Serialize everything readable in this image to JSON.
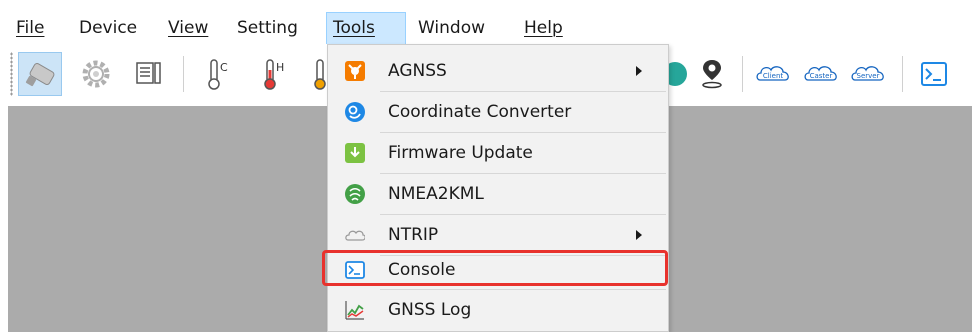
{
  "menubar": {
    "items": [
      {
        "label": "File"
      },
      {
        "label": "Device"
      },
      {
        "label": "View"
      },
      {
        "label": "Setting"
      },
      {
        "label": "Tools"
      },
      {
        "label": "Window"
      },
      {
        "label": "Help"
      }
    ],
    "open_menu": "Tools"
  },
  "toolbar": {
    "icons": [
      "connect-icon",
      "settings-gear-icon",
      "document-icon",
      "thermometer-cold-icon",
      "thermometer-hot-icon",
      "thermometer-icon",
      "globe-icon",
      "location-pin-icon",
      "client-cloud-icon",
      "caster-cloud-icon",
      "server-cloud-icon",
      "console-icon"
    ],
    "client_label": "Client",
    "caster_label": "Caster",
    "server_label": "Server",
    "thermo_c_label": "C",
    "thermo_h_label": "H"
  },
  "tools_menu": {
    "items": [
      {
        "label": "AGNSS",
        "icon": "agnss-icon",
        "submenu": true
      },
      {
        "label": "Coordinate Converter",
        "icon": "coordinate-converter-icon",
        "submenu": false
      },
      {
        "label": "Firmware Update",
        "icon": "firmware-update-icon",
        "submenu": false
      },
      {
        "label": "NMEA2KML",
        "icon": "nmea2kml-icon",
        "submenu": false
      },
      {
        "label": "NTRIP",
        "icon": "ntrip-cloud-icon",
        "submenu": true
      },
      {
        "label": "Console",
        "icon": "console-icon",
        "submenu": false,
        "highlighted": true
      },
      {
        "label": "GNSS Log",
        "icon": "gnss-log-icon",
        "submenu": false
      }
    ]
  },
  "colors": {
    "menu_open_bg": "#cce8ff",
    "workarea_bg": "#ababab",
    "dropdown_bg": "#f2f2f2",
    "highlight_red": "#e8322d",
    "accent_blue": "#1e88e5"
  }
}
